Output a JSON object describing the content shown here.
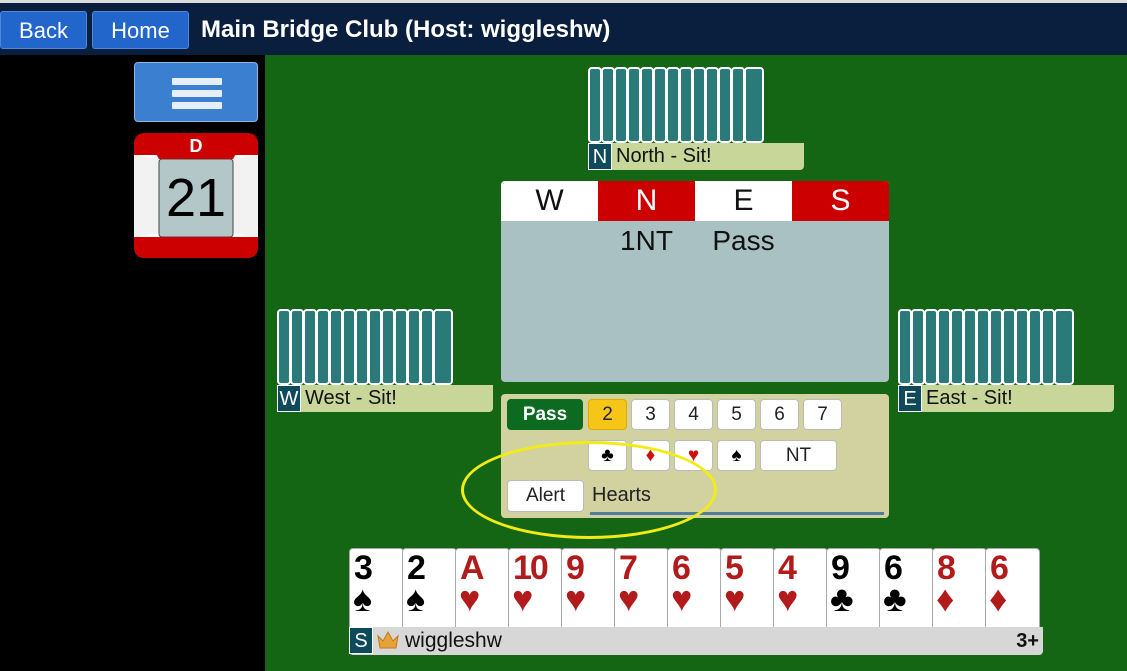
{
  "nav": {
    "back_label": "Back",
    "home_label": "Home",
    "title": "Main Bridge Club (Host: wiggleshw)"
  },
  "board": {
    "dealer": "D",
    "number": "21"
  },
  "north": {
    "seat": "N",
    "label": "North - Sit!",
    "cards": 13
  },
  "west": {
    "seat": "W",
    "label": "West - Sit!",
    "cards": 13
  },
  "east": {
    "seat": "E",
    "label": "East - Sit!",
    "cards": 13
  },
  "auction": {
    "headers": [
      "W",
      "N",
      "E",
      "S"
    ],
    "header_vulnerable": [
      false,
      true,
      false,
      true
    ],
    "bids": [
      "",
      "1NT",
      "Pass",
      ""
    ]
  },
  "bidbox": {
    "pass_label": "Pass",
    "levels": [
      "2",
      "3",
      "4",
      "5",
      "6",
      "7"
    ],
    "selected_level": "2",
    "suits": [
      {
        "symbol": "♣",
        "name": "clubs",
        "color": "#000000"
      },
      {
        "symbol": "♦",
        "name": "diamonds",
        "color": "#cc1111"
      },
      {
        "symbol": "♥",
        "name": "hearts",
        "color": "#cc1111"
      },
      {
        "symbol": "♠",
        "name": "spades",
        "color": "#000000"
      }
    ],
    "nt_label": "NT",
    "alert_label": "Alert",
    "alert_text": "Hearts"
  },
  "south": {
    "seat": "S",
    "player": "wiggleshw",
    "rating": "3+",
    "crown_icon": "crown-icon",
    "cards": [
      {
        "rank": "3",
        "suit": "♠",
        "color": "black"
      },
      {
        "rank": "2",
        "suit": "♠",
        "color": "black"
      },
      {
        "rank": "A",
        "suit": "♥",
        "color": "red"
      },
      {
        "rank": "10",
        "suit": "♥",
        "color": "red"
      },
      {
        "rank": "9",
        "suit": "♥",
        "color": "red"
      },
      {
        "rank": "7",
        "suit": "♥",
        "color": "red"
      },
      {
        "rank": "6",
        "suit": "♥",
        "color": "red"
      },
      {
        "rank": "5",
        "suit": "♥",
        "color": "red"
      },
      {
        "rank": "4",
        "suit": "♥",
        "color": "red"
      },
      {
        "rank": "9",
        "suit": "♣",
        "color": "black"
      },
      {
        "rank": "6",
        "suit": "♣",
        "color": "black"
      },
      {
        "rank": "8",
        "suit": "♦",
        "color": "red"
      },
      {
        "rank": "6",
        "suit": "♦",
        "color": "red"
      }
    ]
  },
  "colors": {
    "felt": "#146614",
    "header": "#0a1f3d",
    "vulnerable": "#cc0000",
    "highlight_ellipse": "#f2ec14"
  }
}
